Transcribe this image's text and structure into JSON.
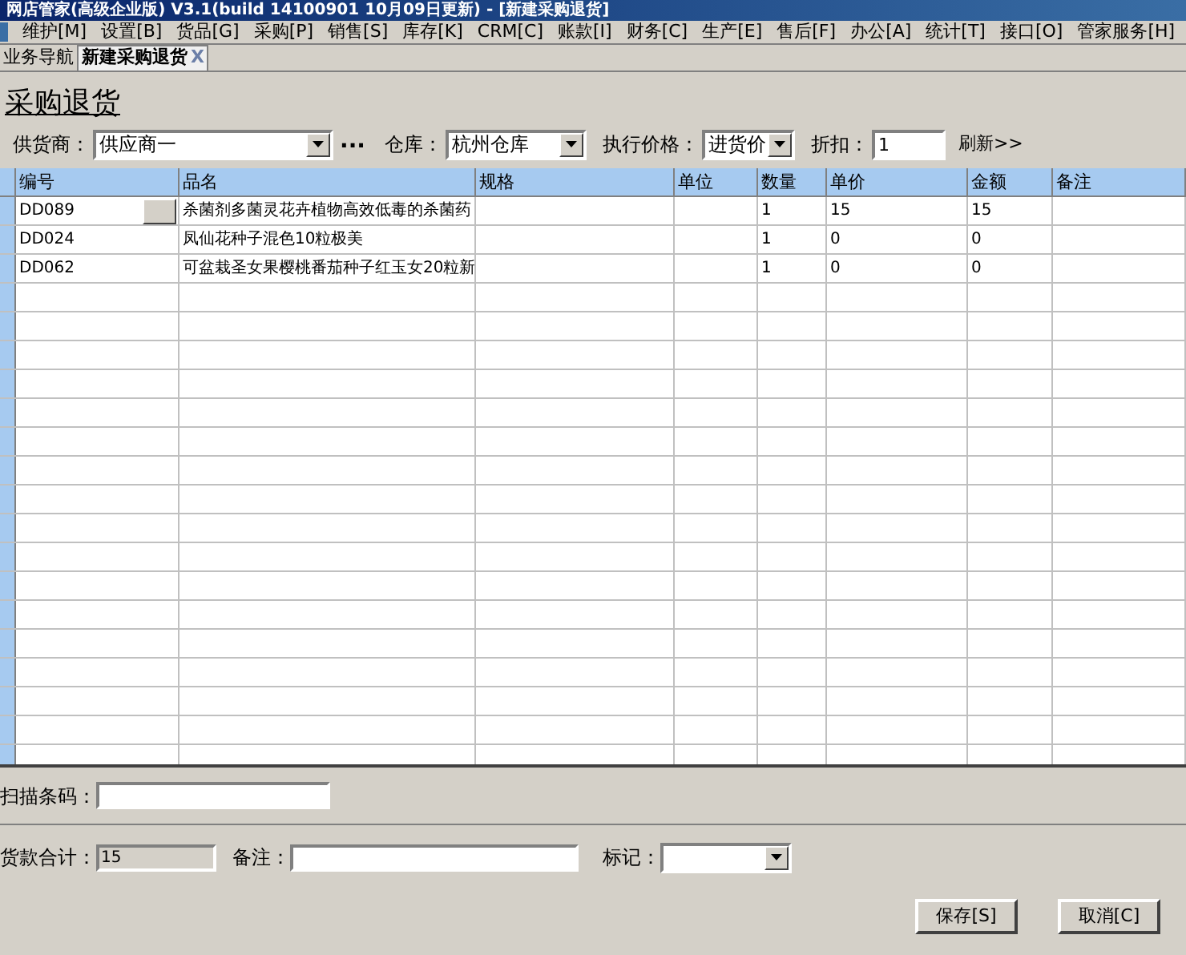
{
  "window": {
    "title": "网店管家(高级企业版) V3.1(build 14100901 10月09日更新) - [新建采购退货]"
  },
  "menu": [
    "维护[M]",
    "设置[B]",
    "货品[G]",
    "采购[P]",
    "销售[S]",
    "库存[K]",
    "CRM[C]",
    "账款[I]",
    "财务[C]",
    "生产[E]",
    "售后[F]",
    "办公[A]",
    "统计[T]",
    "接口[O]",
    "管家服务[H]"
  ],
  "tabs": [
    {
      "label": "业务导航",
      "selected": false,
      "closable": false
    },
    {
      "label": "新建采购退货",
      "selected": true,
      "closable": true,
      "close": "X"
    }
  ],
  "heading": "采购退货",
  "filters": {
    "supplier": {
      "label": "供货商：",
      "value": "供应商一",
      "more": "..."
    },
    "warehouse": {
      "label": "仓库：",
      "value": "杭州仓库"
    },
    "price": {
      "label": "执行价格：",
      "value": "进货价"
    },
    "discount": {
      "label": "折扣：",
      "value": "1"
    },
    "refresh": "刷新>>"
  },
  "table": {
    "columns": [
      "编号",
      "品名",
      "规格",
      "单位",
      "数量",
      "单价",
      "金额",
      "备注"
    ],
    "rows": [
      {
        "code": "DD089",
        "name": "杀菌剂多菌灵花卉植物高效低毒的杀菌药",
        "spec": "",
        "unit": "",
        "qty": "1",
        "price": "15",
        "amount": "15",
        "note": "",
        "picker": true
      },
      {
        "code": "DD024",
        "name": "凤仙花种子混色10粒极美",
        "spec": "",
        "unit": "",
        "qty": "1",
        "price": "0",
        "amount": "0",
        "note": "",
        "picker": false
      },
      {
        "code": "DD062",
        "name": "可盆栽圣女果樱桃番茄种子红玉女20粒新",
        "spec": "",
        "unit": "",
        "qty": "1",
        "price": "0",
        "amount": "0",
        "note": "",
        "picker": false
      }
    ]
  },
  "barcode": {
    "label": "扫描条码："
  },
  "summary": {
    "total_label": "货款合计：",
    "total": "15",
    "remark_label": "备注：",
    "mark_label": "标记："
  },
  "buttons": [
    "保存[S]",
    "取消[C]"
  ]
}
